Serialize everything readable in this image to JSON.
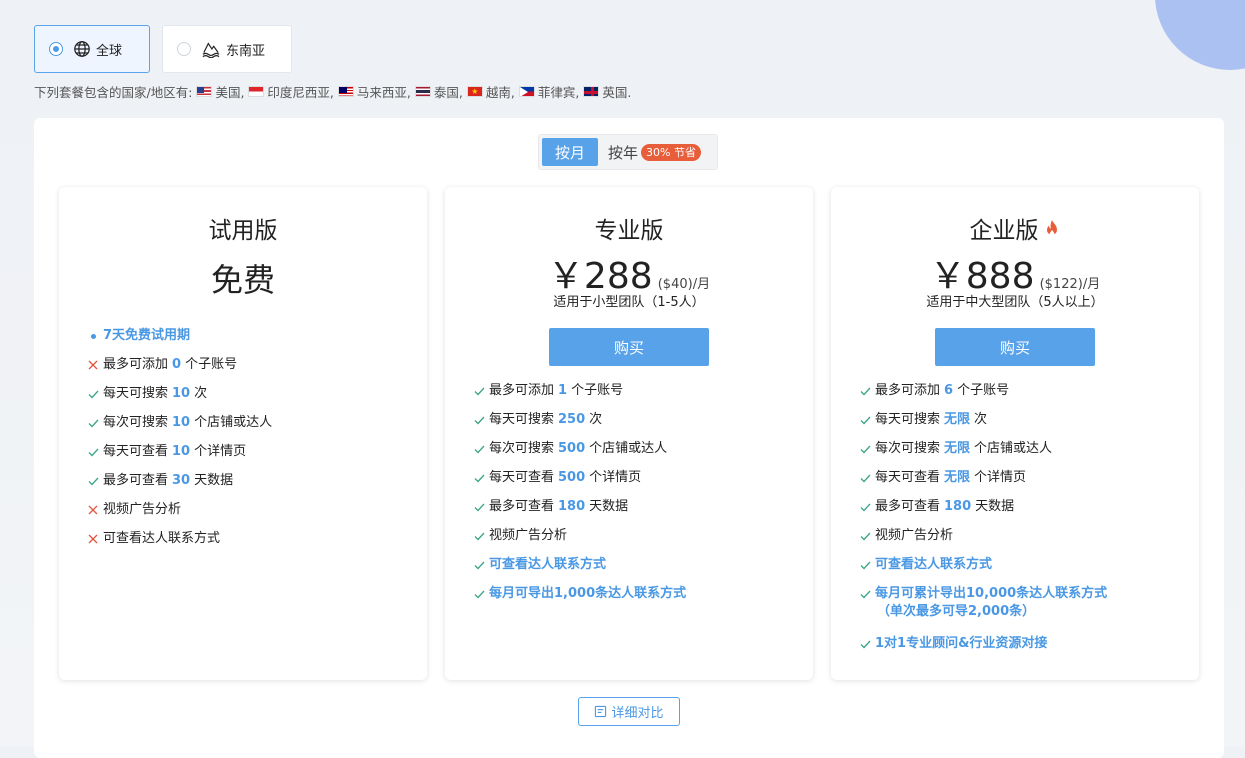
{
  "regions": [
    {
      "label": "全球",
      "selected": true,
      "icon": "globe-icon"
    },
    {
      "label": "东南亚",
      "selected": false,
      "icon": "waves-icon"
    }
  ],
  "countries": {
    "prefix": "下列套餐包含的国家/地区有:",
    "list": [
      {
        "name": "美国,",
        "flag": "us-flag-icon"
      },
      {
        "name": "印度尼西亚,",
        "flag": "id-flag-icon"
      },
      {
        "name": "马来西亚,",
        "flag": "my-flag-icon"
      },
      {
        "name": "泰国,",
        "flag": "th-flag-icon"
      },
      {
        "name": "越南,",
        "flag": "vn-flag-icon"
      },
      {
        "name": "菲律宾,",
        "flag": "ph-flag-icon"
      },
      {
        "name": "英国.",
        "flag": "gb-flag-icon"
      }
    ]
  },
  "billing": {
    "monthly": "按月",
    "yearly": "按年",
    "badge": "30% 节省",
    "selected": "monthly"
  },
  "plans": {
    "trial": {
      "name": "试用版",
      "price": "免费",
      "features": [
        {
          "type": "dot",
          "style": "highlight",
          "text": "7天免费试用期"
        },
        {
          "type": "cross",
          "pre": "最多可添加",
          "num": "0",
          "post": "个子账号"
        },
        {
          "type": "check",
          "pre": "每天可搜索",
          "num": "10",
          "post": "次"
        },
        {
          "type": "check",
          "pre": "每次可搜索",
          "num": "10",
          "post": "个店铺或达人"
        },
        {
          "type": "check",
          "pre": "每天可查看",
          "num": "10",
          "post": "个详情页"
        },
        {
          "type": "check",
          "pre": "最多可查看",
          "num": "30",
          "post": "天数据"
        },
        {
          "type": "cross",
          "pre": "视频广告分析"
        },
        {
          "type": "cross",
          "pre": "可查看达人联系方式"
        }
      ]
    },
    "pro": {
      "name": "专业版",
      "price": "￥288",
      "price_usd": "($40)/月",
      "audience": "适用于小型团队（1-5人）",
      "buy_label": "购买",
      "features": [
        {
          "type": "check",
          "pre": "最多可添加",
          "num": "1",
          "post": "个子账号"
        },
        {
          "type": "check",
          "pre": "每天可搜索",
          "num": "250",
          "post": "次"
        },
        {
          "type": "check",
          "pre": "每次可搜索",
          "num": "500",
          "post": "个店铺或达人"
        },
        {
          "type": "check",
          "pre": "每天可查看",
          "num": "500",
          "post": "个详情页"
        },
        {
          "type": "check",
          "pre": "最多可查看",
          "num": "180",
          "post": "天数据"
        },
        {
          "type": "check",
          "pre": "视频广告分析"
        },
        {
          "type": "check",
          "style": "highlight",
          "pre": "可查看达人联系方式"
        },
        {
          "type": "check",
          "style": "highlight",
          "pre": "每月可导出1,000条达人联系方式"
        }
      ]
    },
    "enterprise": {
      "name": "企业版",
      "price": "￥888",
      "price_usd": "($122)/月",
      "audience": "适用于中大型团队（5人以上）",
      "buy_label": "购买",
      "features": [
        {
          "type": "check",
          "pre": "最多可添加",
          "num": "6",
          "post": "个子账号"
        },
        {
          "type": "check",
          "pre": "每天可搜索",
          "num": "无限",
          "post": "次"
        },
        {
          "type": "check",
          "pre": "每次可搜索",
          "num": "无限",
          "post": "个店铺或达人"
        },
        {
          "type": "check",
          "pre": "每天可查看",
          "num": "无限",
          "post": "个详情页"
        },
        {
          "type": "check",
          "pre": "最多可查看",
          "num": "180",
          "post": "天数据"
        },
        {
          "type": "check",
          "pre": "视频广告分析"
        },
        {
          "type": "check",
          "style": "highlight",
          "pre": "可查看达人联系方式"
        },
        {
          "type": "check",
          "style": "highlight",
          "pre": "每月可累计导出10,000条达人联系方式",
          "sub": "（单次最多可导2,000条）"
        },
        {
          "type": "check",
          "style": "highlight",
          "pre": "1对1专业顾问&行业资源对接"
        }
      ]
    }
  },
  "compare_label": "详细对比",
  "colors": {
    "accent": "#58a2ea",
    "highlight": "#4a98e4",
    "check": "#3ba58a",
    "cross": "#e4553d",
    "badge": "#e85d3a"
  }
}
